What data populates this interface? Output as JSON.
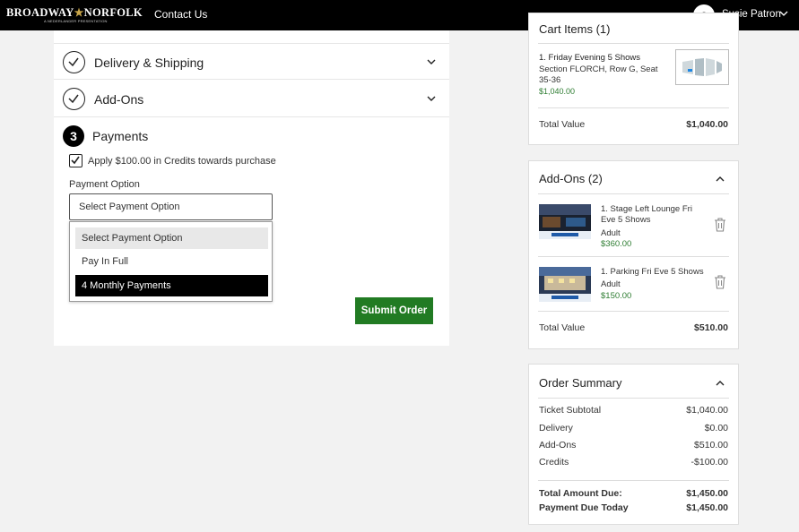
{
  "header": {
    "logo_text": "BROADWAY",
    "logo_text2": "NORFOLK",
    "logo_sub": "A NEDERLANDER PRESENTATION",
    "contact_label": "Contact Us",
    "avatar_initial": "S",
    "user_name": "Susie Patron"
  },
  "checkout": {
    "sections": [
      {
        "label": "Delivery & Shipping"
      },
      {
        "label": "Add-Ons"
      }
    ],
    "payments": {
      "step_number": "3",
      "title": "Payments",
      "credit_checked": true,
      "credit_label": "Apply $100.00 in Credits towards purchase",
      "option_label": "Payment Option",
      "select_value": "Select Payment Option",
      "options": [
        "Select Payment Option",
        "Pay In Full",
        "4 Monthly Payments"
      ],
      "submit_label": "Submit Order"
    }
  },
  "cart": {
    "title": "Cart Items (1)",
    "item_name": "1. Friday Evening 5 Shows",
    "item_seat": "Section FLORCH, Row G, Seat 35-36",
    "item_price": "$1,040.00",
    "total_label": "Total Value",
    "total_value": "$1,040.00"
  },
  "addons": {
    "title": "Add-Ons (2)",
    "items": [
      {
        "name": "1. Stage Left Lounge Fri Eve 5 Shows",
        "type": "Adult",
        "price": "$360.00"
      },
      {
        "name": "1. Parking Fri Eve 5 Shows",
        "type": "Adult",
        "price": "$150.00"
      }
    ],
    "total_label": "Total Value",
    "total_value": "$510.00"
  },
  "summary": {
    "title": "Order Summary",
    "rows": [
      {
        "label": "Ticket Subtotal",
        "value": "$1,040.00"
      },
      {
        "label": "Delivery",
        "value": "$0.00"
      },
      {
        "label": "Add-Ons",
        "value": "$510.00"
      },
      {
        "label": "Credits",
        "value": "-$100.00"
      }
    ],
    "due_label": "Total Amount Due:",
    "due_value": "$1,450.00",
    "today_label": "Payment Due Today",
    "today_value": "$1,450.00"
  },
  "colors": {
    "accent_green": "#217b23",
    "topbar": "#000000"
  }
}
